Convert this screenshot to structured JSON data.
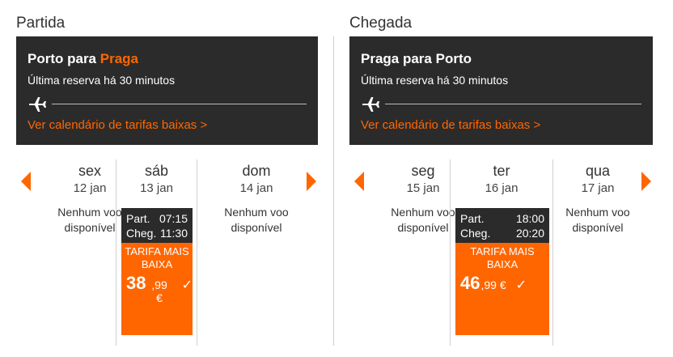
{
  "outbound": {
    "heading": "Partida",
    "route_from": "Porto para",
    "route_to": "Praga",
    "last_booking": "Última reserva há 30 minutos",
    "calendar_link": "Ver calendário de tarifas baixas >",
    "days": [
      {
        "name": "sex",
        "date": "12 jan",
        "no_flight_1": "Nenhum voo",
        "no_flight_2": "disponível"
      },
      {
        "name": "sáb",
        "date": "13 jan",
        "dep_label": "Part.",
        "dep_time": "07:15",
        "arr_label": "Cheg.",
        "arr_time": "11:30",
        "tag_1": "TARIFA MAIS",
        "tag_2": "BAIXA",
        "price_int": "38",
        "price_dec": ",99 €"
      },
      {
        "name": "dom",
        "date": "14 jan",
        "no_flight_1": "Nenhum voo",
        "no_flight_2": "disponível"
      }
    ]
  },
  "inbound": {
    "heading": "Chegada",
    "route": "Praga para Porto",
    "last_booking": "Última reserva há 30 minutos",
    "calendar_link": "Ver calendário de tarifas baixas >",
    "days": [
      {
        "name": "seg",
        "date": "15 jan",
        "no_flight_1": "Nenhum voo",
        "no_flight_2": "disponível"
      },
      {
        "name": "ter",
        "date": "16 jan",
        "dep_label": "Part.",
        "dep_time": "18:00",
        "arr_label": "Cheg.",
        "arr_time": "20:20",
        "tag_1": "TARIFA MAIS",
        "tag_2": "BAIXA",
        "price_int": "46",
        "price_dec": ",99 €"
      },
      {
        "name": "qua",
        "date": "17 jan",
        "no_flight_1": "Nenhum voo",
        "no_flight_2": "disponível"
      }
    ]
  },
  "icons": {
    "plane": "plane-icon",
    "prev": "chevron-left-icon",
    "next": "chevron-right-icon",
    "check": "check-icon"
  },
  "colors": {
    "accent": "#ff6600",
    "dark": "#2b2b2b"
  }
}
